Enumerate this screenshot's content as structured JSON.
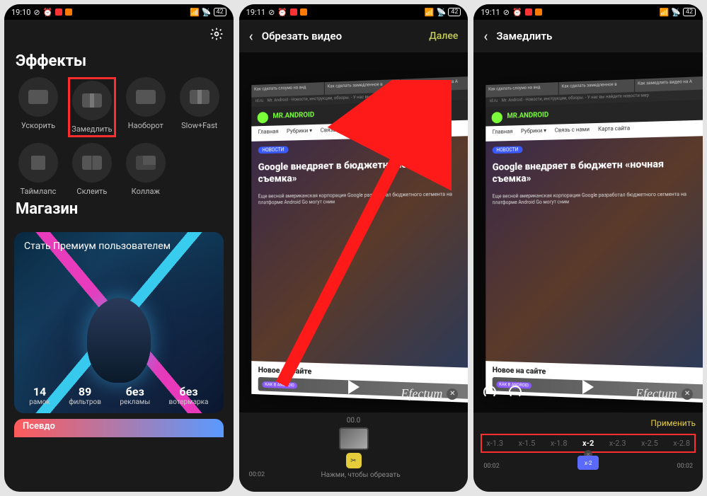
{
  "status": {
    "time1": "19:10",
    "time23": "19:11",
    "battery": "42"
  },
  "screen1": {
    "section_effects": "Эффекты",
    "effects": [
      {
        "label": "Ускорить",
        "icon": "fast"
      },
      {
        "label": "Замедлить",
        "icon": "slow",
        "highlight": true
      },
      {
        "label": "Наоборот",
        "icon": "rev"
      },
      {
        "label": "Slow+Fast",
        "icon": "slow"
      },
      {
        "label": "Таймлапс",
        "icon": "stop"
      },
      {
        "label": "Склеить",
        "icon": "split"
      },
      {
        "label": "Коллаж",
        "icon": "grid"
      }
    ],
    "section_store": "Магазин",
    "promo_title": "Стать Премиум пользователем",
    "stats": [
      {
        "value": "14",
        "label": "рамок"
      },
      {
        "value": "89",
        "label": "фильтров"
      },
      {
        "value": "без",
        "label": "рекламы"
      },
      {
        "value": "без",
        "label": "вотермарка"
      }
    ],
    "bottom_thumb_label": "Псевдо"
  },
  "screen2": {
    "title": "Обрезать видео",
    "action": "Далее",
    "watermark": "Efectum",
    "trim_time": "00.0",
    "trim_start": "00:02",
    "trim_hint": "Нажми, чтобы обрезать"
  },
  "screen3": {
    "title": "Замедлить",
    "watermark": "Efectum",
    "apply": "Применить",
    "speeds": [
      "x-1.3",
      "x-1.5",
      "x-1.8",
      "x-2",
      "x-2.3",
      "x-2.5",
      "x-2.8"
    ],
    "speed_active_index": 3,
    "marker_label": "x-2",
    "tl_start": "00:02",
    "tl_end": "00:02"
  },
  "mock": {
    "tab1": "Как сделать слоумо на анд",
    "tab2": "Как сделать замедленное в",
    "tab3": "Как замедлить видео на А",
    "url": "id.ru",
    "site_sub": "Mr. Android - Новости, инструкции, обзоры. - У нас вы найдете новости мир",
    "logo": "MR.ANDROID",
    "nav_items": [
      "Главная",
      "Рубрики ▾",
      "Связь с нами",
      "Карта сайта"
    ],
    "badge": "НОВОСТИ",
    "headline": "Google внедряет в бюджетн «ночная съемка»",
    "sub": "Еще весной американская корпорация Google разработал бюджетного сегмента на платформе Android Go могут сним",
    "section": "Новое на сайте",
    "card_badge": "КАК В ANDROID"
  }
}
